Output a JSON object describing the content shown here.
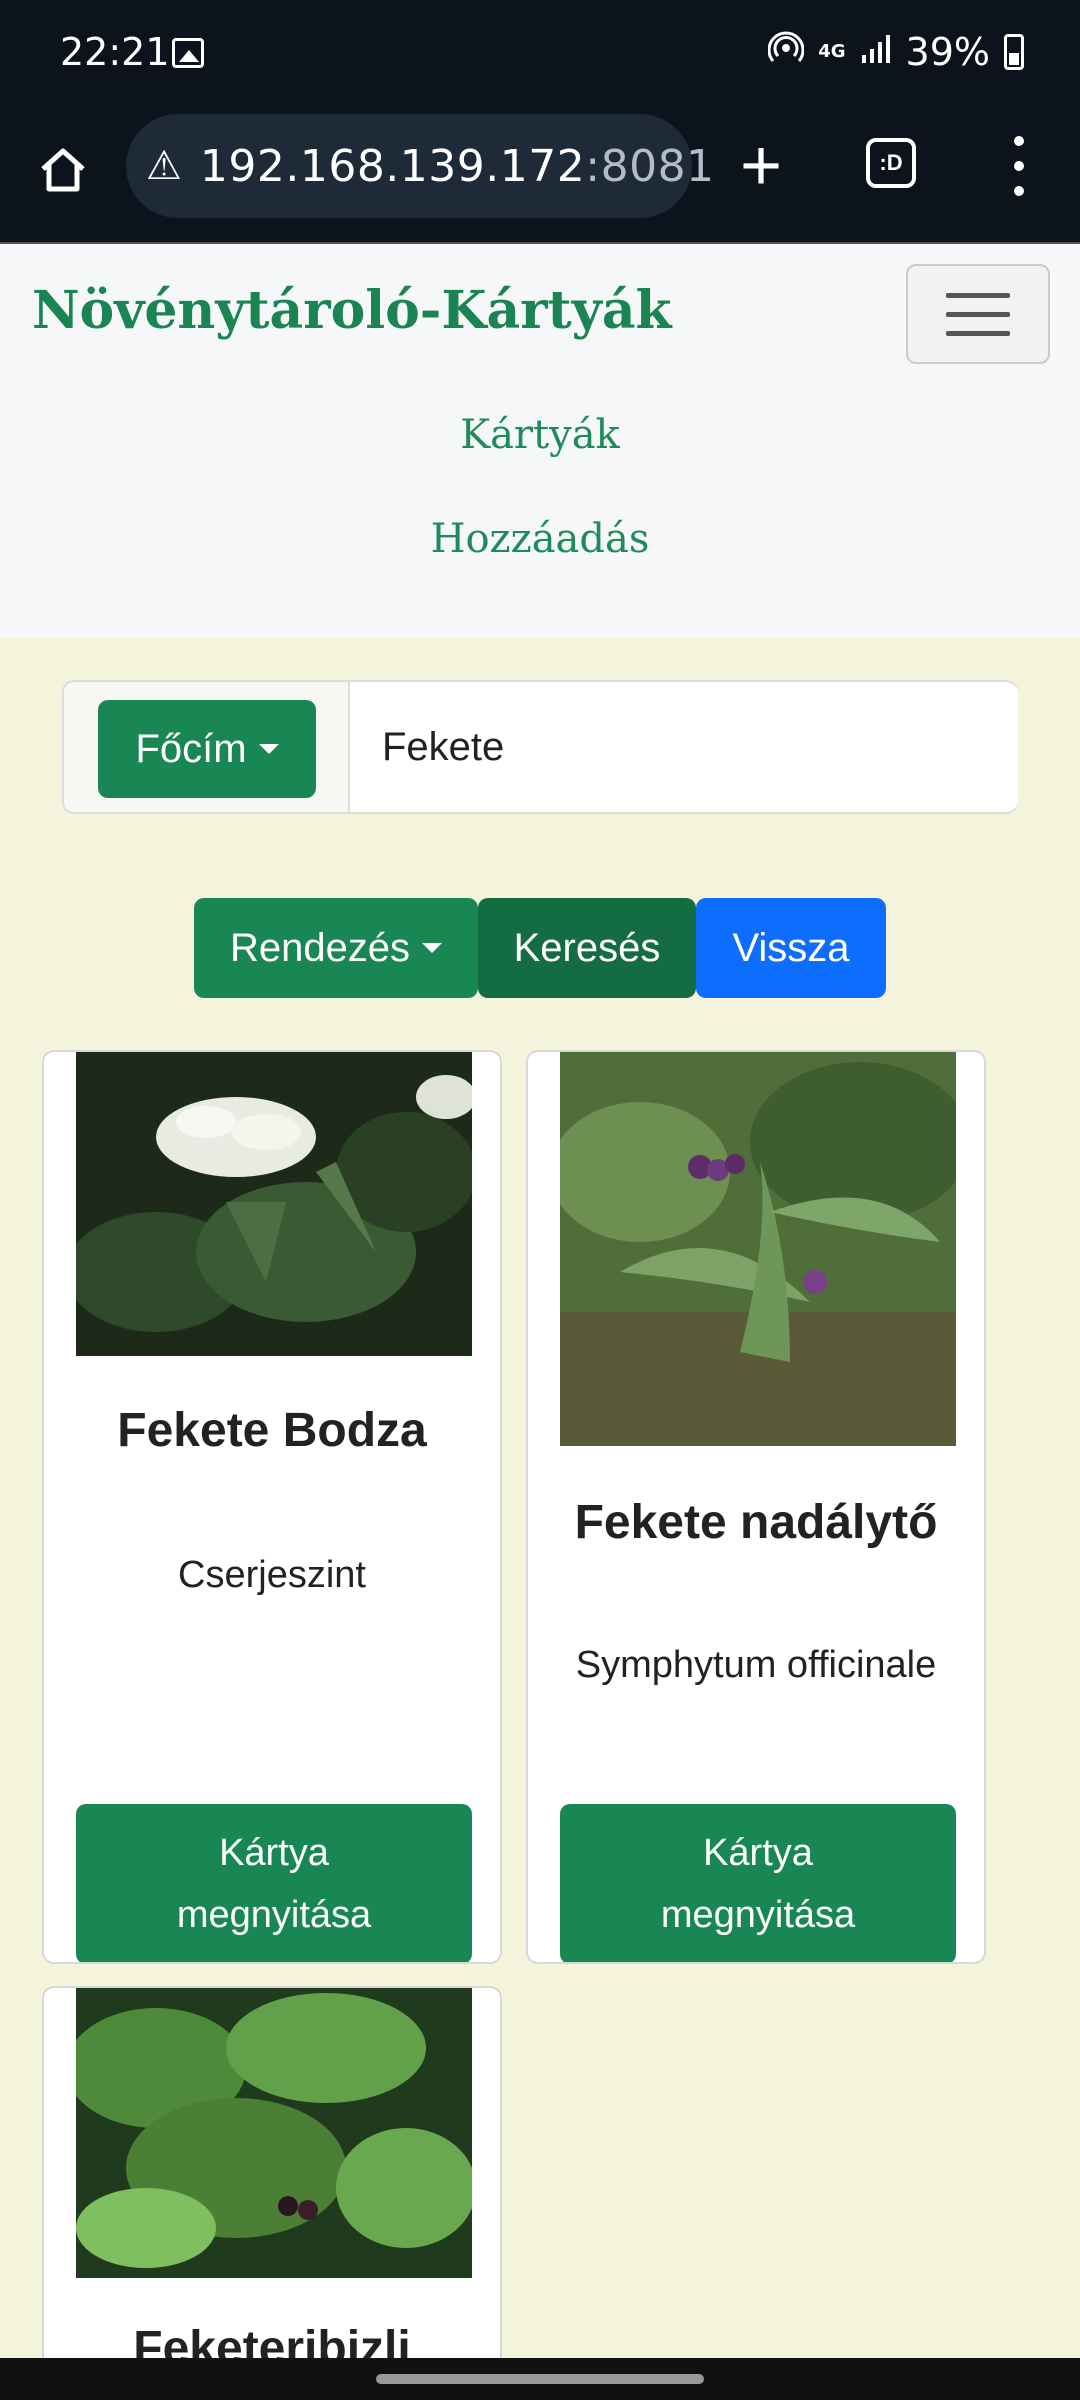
{
  "status_bar": {
    "time": "22:21",
    "battery": "39%",
    "network_label": "4G",
    "icons": [
      "image-icon",
      "hotspot-icon",
      "network-4g-icon",
      "signal-icon",
      "battery-icon"
    ]
  },
  "browser": {
    "url_host": "192.168.139.172",
    "url_port": ":8081",
    "tab_label": ":D",
    "icons": [
      "home-icon",
      "warning-icon",
      "new-tab-icon",
      "tabs-icon",
      "more-menu-icon"
    ]
  },
  "navbar": {
    "brand": "Növénytároló-Kártyák",
    "links": [
      {
        "label": "Kártyák"
      },
      {
        "label": "Hozzáadás"
      }
    ],
    "icons": [
      "hamburger-icon"
    ]
  },
  "search": {
    "field_button": "Főcím",
    "value": "Fekete"
  },
  "actions": {
    "sort": "Rendezés",
    "search": "Keresés",
    "back": "Vissza"
  },
  "cards": [
    {
      "title": "Fekete Bodza",
      "subtitle": "Cserjeszint",
      "button": "Kártya megnyitása"
    },
    {
      "title": "Fekete nadálytő",
      "subtitle": "Symphytum officinale",
      "button": "Kártya megnyitása"
    },
    {
      "title": "Feketeribizli",
      "subtitle": "",
      "button": ""
    }
  ],
  "colors": {
    "primary_green": "#198754",
    "dark_green": "#146c43",
    "blue": "#0d6efd",
    "page_bg": "#f4f3dc",
    "brand_green": "#1a8453"
  }
}
